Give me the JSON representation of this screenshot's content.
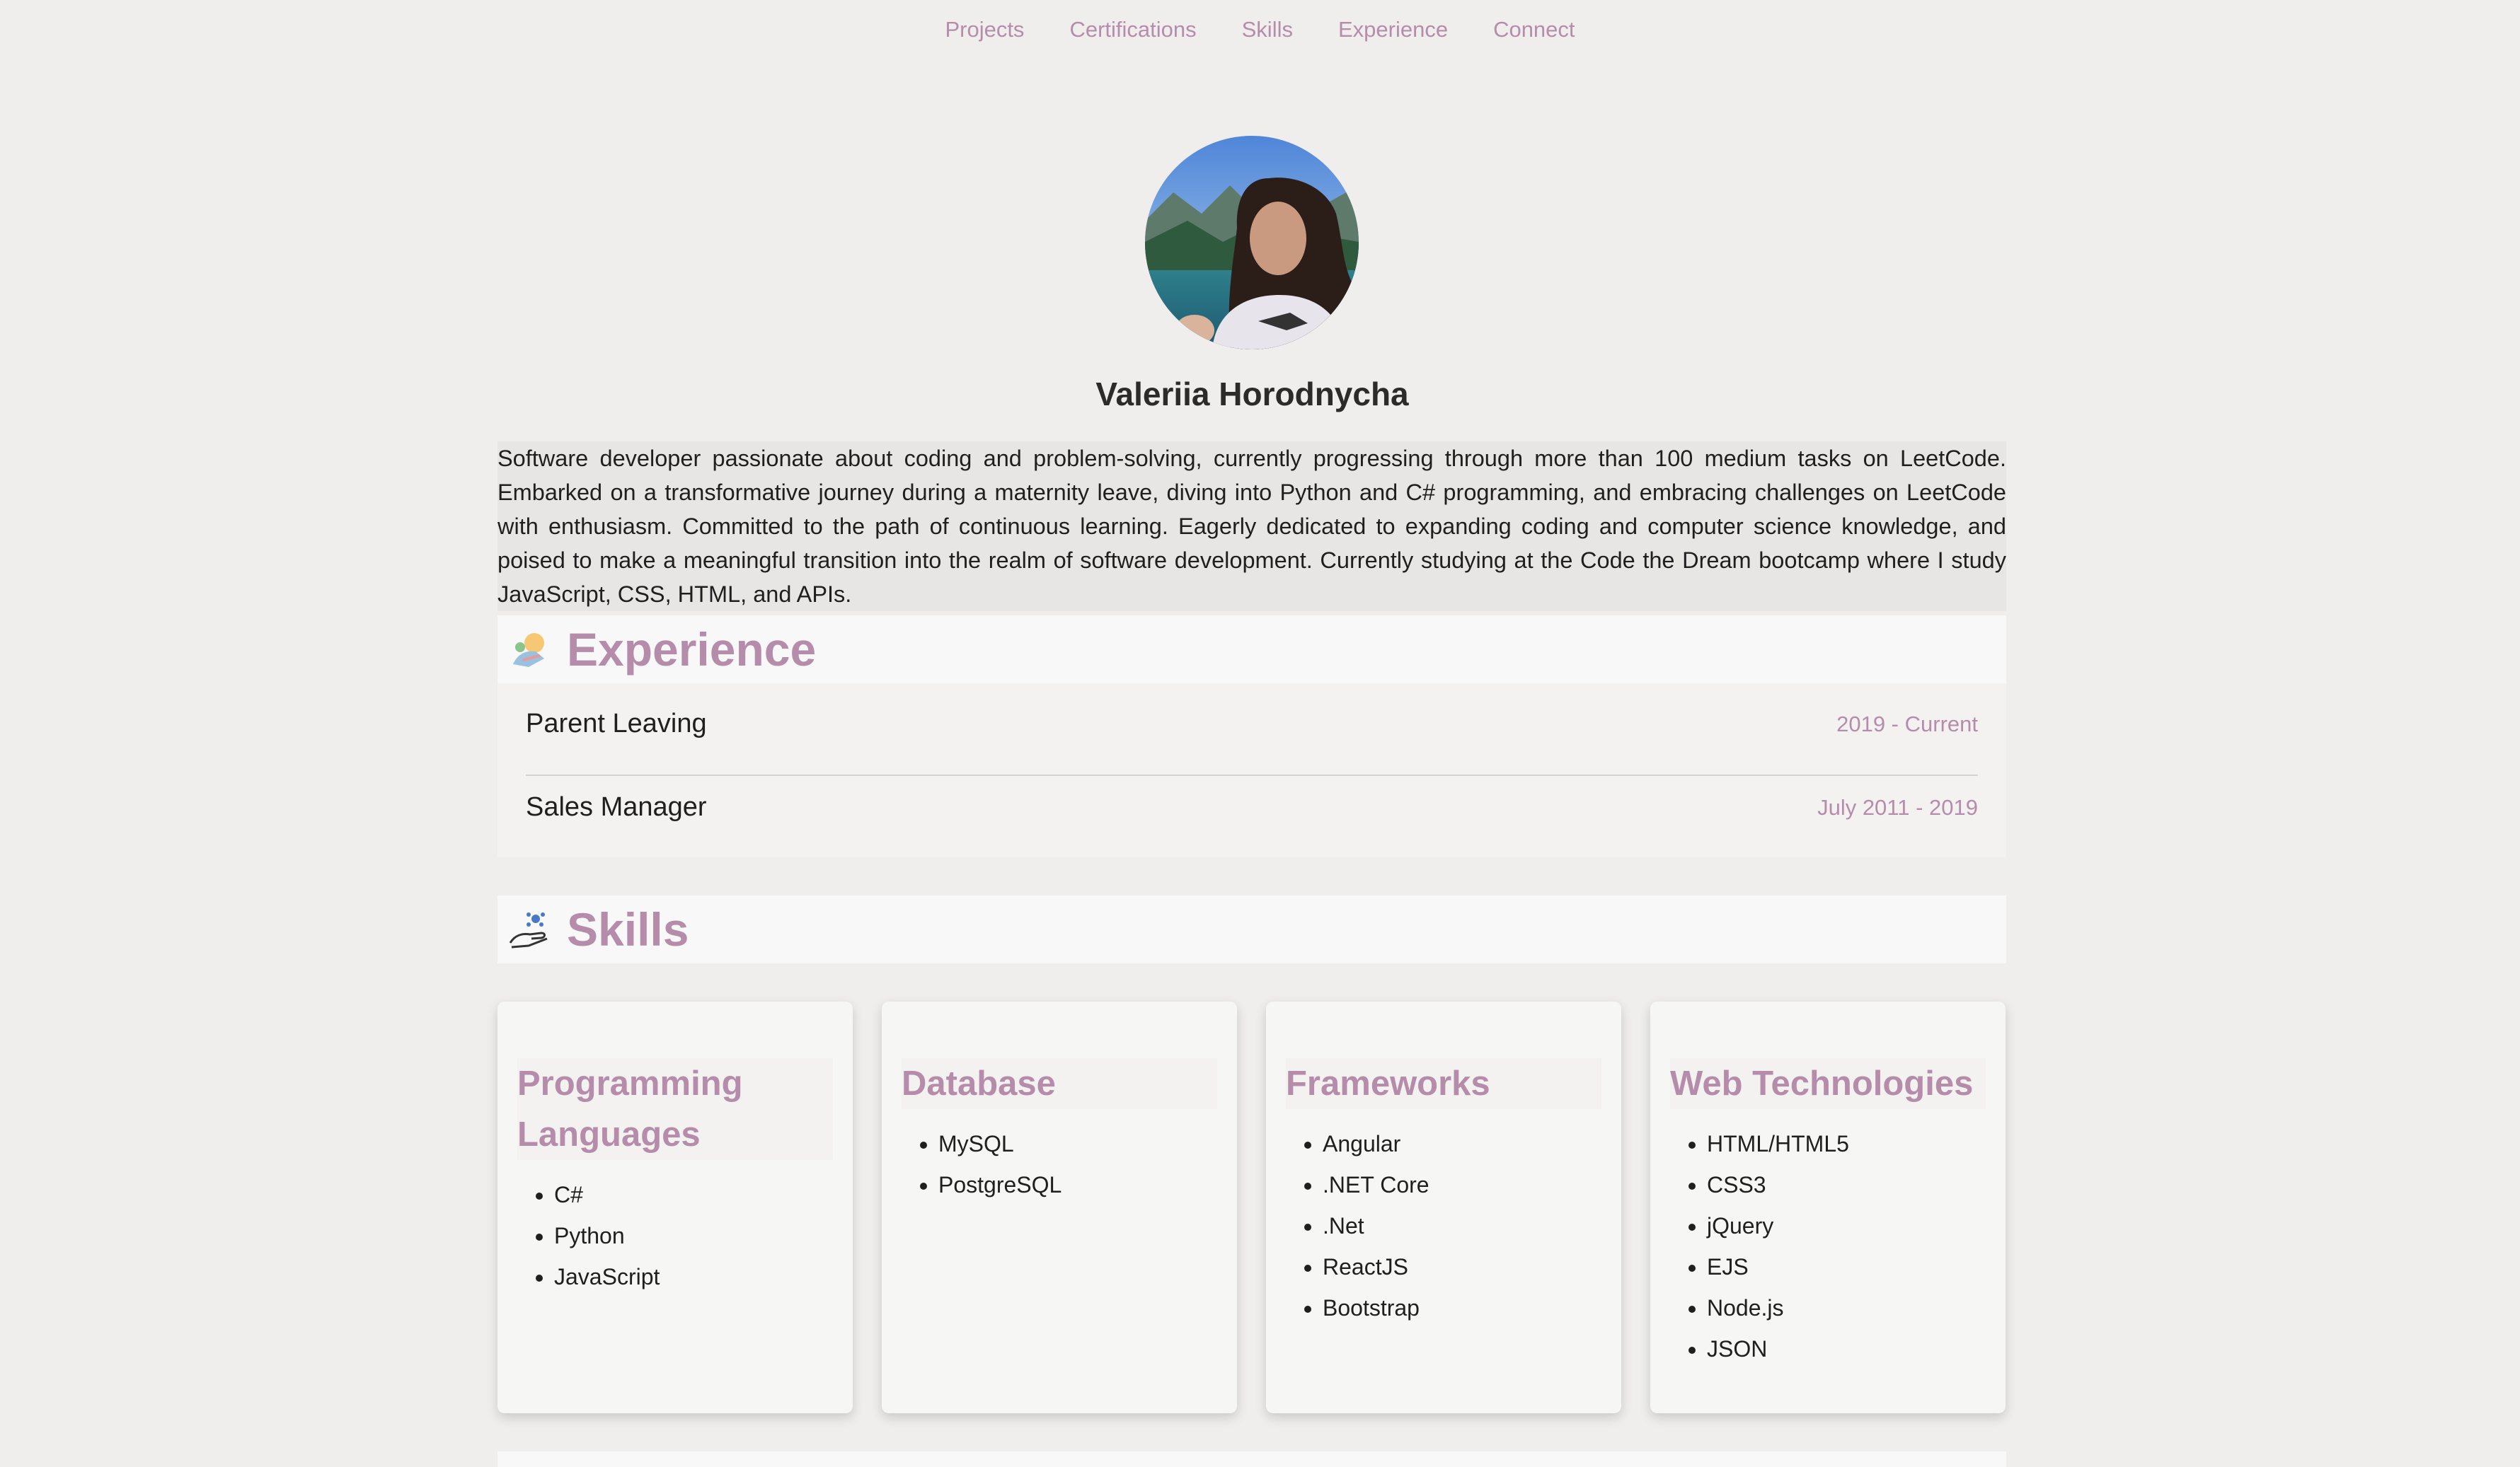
{
  "nav": {
    "items": [
      "Projects",
      "Certifications",
      "Skills",
      "Experience",
      "Connect"
    ]
  },
  "profile": {
    "name": "Valeriia Horodnycha",
    "about": "Software developer passionate about coding and problem-solving, currently progressing through more than 100 medium tasks on LeetCode. Embarked on a transformative journey during a maternity leave, diving into Python and C# programming, and embracing challenges on LeetCode with enthusiasm. Committed to the path of continuous learning. Eagerly dedicated to expanding coding and computer science knowledge, and poised to make a meaningful transition into the realm of software development. Currently studying at the Code the Dream bootcamp where I study JavaScript, CSS, HTML, and APIs."
  },
  "experience": {
    "heading": "Experience",
    "icon": "experience-icon",
    "items": [
      {
        "title": "Parent Leaving",
        "dates": "2019 - Current"
      },
      {
        "title": "Sales Manager",
        "dates": "July 2011 - 2019"
      }
    ]
  },
  "skills": {
    "heading": "Skills",
    "icon": "skills-hand-icon",
    "cards": [
      {
        "title": "Programming Languages",
        "items": [
          "C#",
          "Python",
          "JavaScript"
        ]
      },
      {
        "title": "Database",
        "items": [
          "MySQL",
          "PostgreSQL"
        ]
      },
      {
        "title": "Frameworks",
        "items": [
          "Angular",
          ".NET Core",
          ".Net",
          "ReactJS",
          "Bootstrap"
        ]
      },
      {
        "title": "Web Technologies",
        "items": [
          "HTML/HTML5",
          "CSS3",
          "jQuery",
          "EJS",
          "Node.js",
          "JSON"
        ]
      }
    ]
  },
  "colors": {
    "accent": "#b58daa",
    "background": "#efeeed",
    "panel": "#f8f8f8"
  }
}
